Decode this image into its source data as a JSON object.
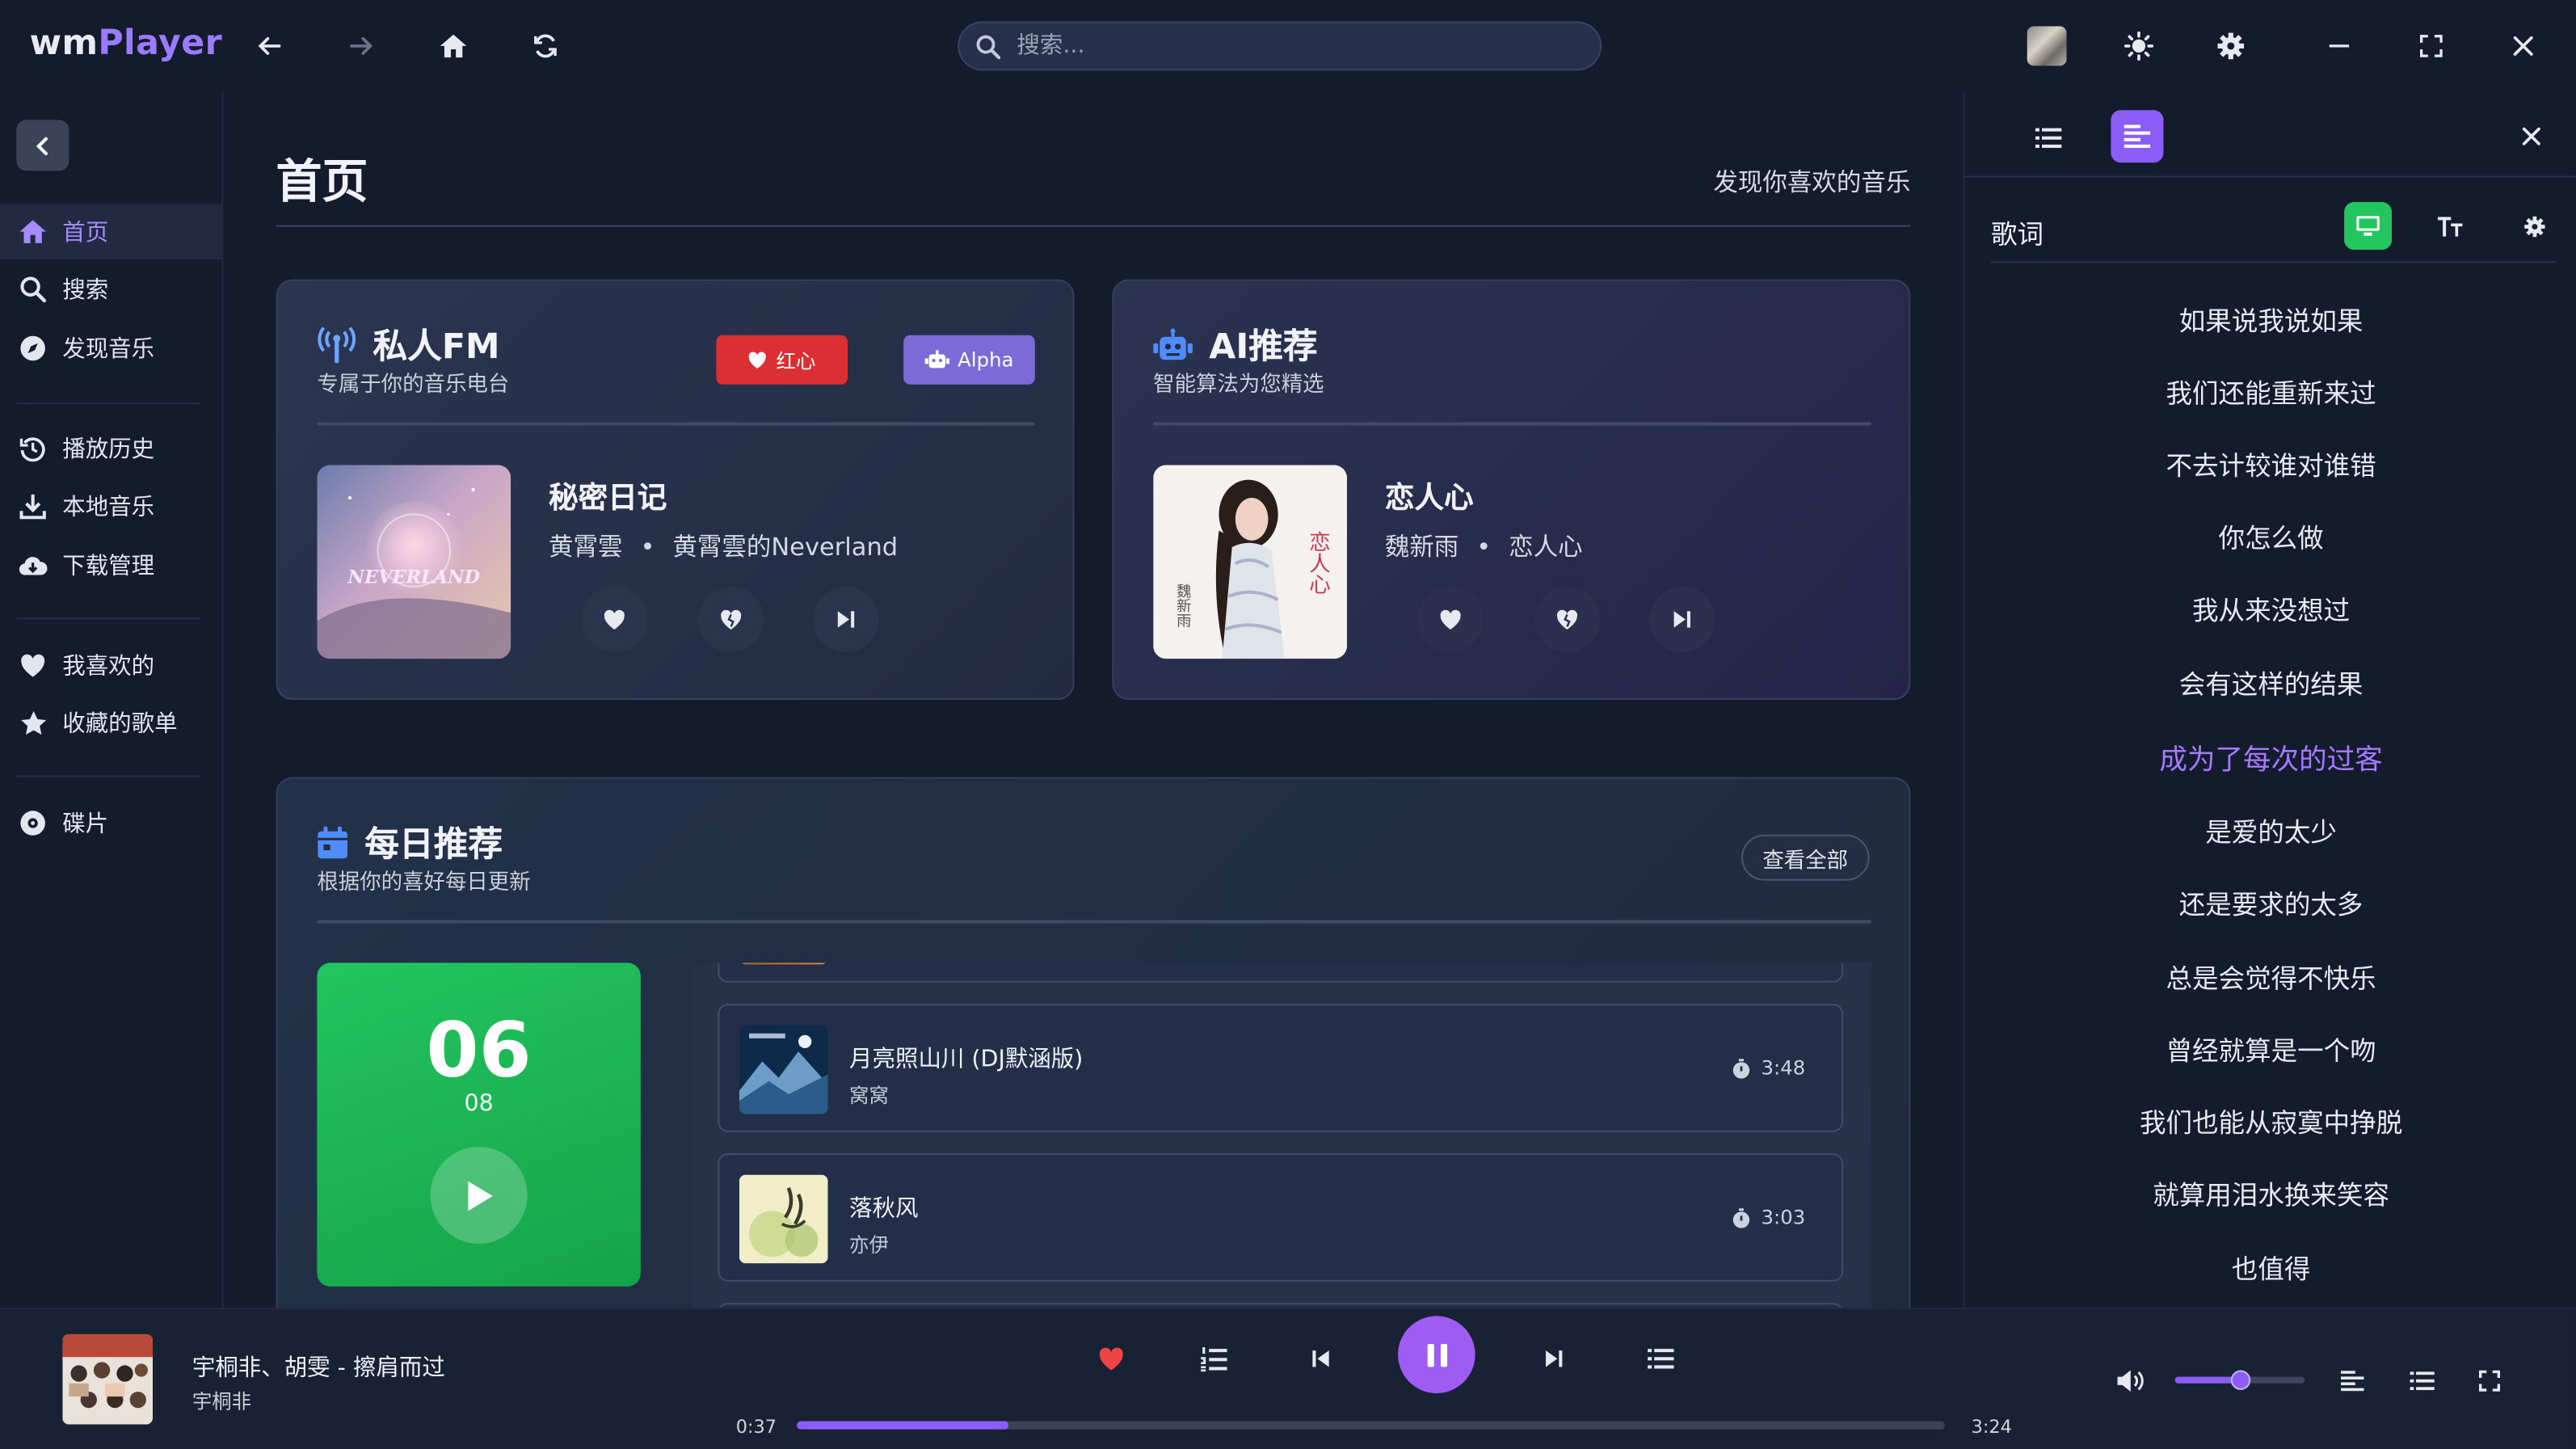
{
  "app": {
    "logo_part1": "wm",
    "logo_part2": "Player"
  },
  "topbar": {
    "search_placeholder": "搜索..."
  },
  "sidebar": {
    "items": [
      {
        "label": "首页",
        "icon": "home-icon",
        "active": true
      },
      {
        "label": "搜索",
        "icon": "search-icon"
      },
      {
        "label": "发现音乐",
        "icon": "compass-icon"
      },
      {
        "label": "播放历史",
        "icon": "history-icon"
      },
      {
        "label": "本地音乐",
        "icon": "download-icon"
      },
      {
        "label": "下载管理",
        "icon": "cloud-download-icon"
      },
      {
        "label": "我喜欢的",
        "icon": "heart-icon"
      },
      {
        "label": "收藏的歌单",
        "icon": "star-icon"
      },
      {
        "label": "碟片",
        "icon": "disc-icon"
      }
    ]
  },
  "main": {
    "title": "首页",
    "subtitle": "发现你喜欢的音乐",
    "fm": {
      "title": "私人FM",
      "subtitle": "专属于你的音乐电台",
      "badge_red": "红心",
      "badge_alpha": "Alpha",
      "song": "秘密日记",
      "artist": "黄霄雲",
      "album": "黄霄雲的Neverland",
      "separator": "•",
      "cover_text": "NEVERLAND"
    },
    "ai": {
      "title": "AI推荐",
      "subtitle": "智能算法为您精选",
      "song": "恋人心",
      "artist": "魏新雨",
      "album": "恋人心",
      "separator": "•",
      "cover_text": "恋人心",
      "cover_text2": "魏新雨"
    },
    "daily": {
      "title": "每日推荐",
      "subtitle": "根据你的喜好每日更新",
      "view_all": "查看全部",
      "day": "06",
      "month": "08",
      "tracks": [
        {
          "name": "月亮照山川 (DJ默涵版)",
          "artist": "窝窝",
          "duration": "3:48"
        },
        {
          "name": "落秋风",
          "artist": "亦伊",
          "duration": "3:03"
        }
      ]
    }
  },
  "lyrics_panel": {
    "title": "歌词",
    "lines": [
      "如果说我说如果",
      "我们还能重新来过",
      "不去计较谁对谁错",
      "你怎么做",
      "我从来没想过",
      "会有这样的结果",
      "成为了每次的过客",
      "是爱的太少",
      "还是要求的太多",
      "总是会觉得不快乐",
      "曾经就算是一个吻",
      "我们也能从寂寞中挣脱",
      "就算用泪水换来笑容",
      "也值得"
    ],
    "current_index": 6
  },
  "player": {
    "title": "宇桐非、胡雯 - 擦肩而过",
    "artist": "宇桐非",
    "current_time": "0:37",
    "total_time": "3:24",
    "progress": 0.185,
    "volume": 0.5,
    "accent": "#8b5cf6"
  }
}
